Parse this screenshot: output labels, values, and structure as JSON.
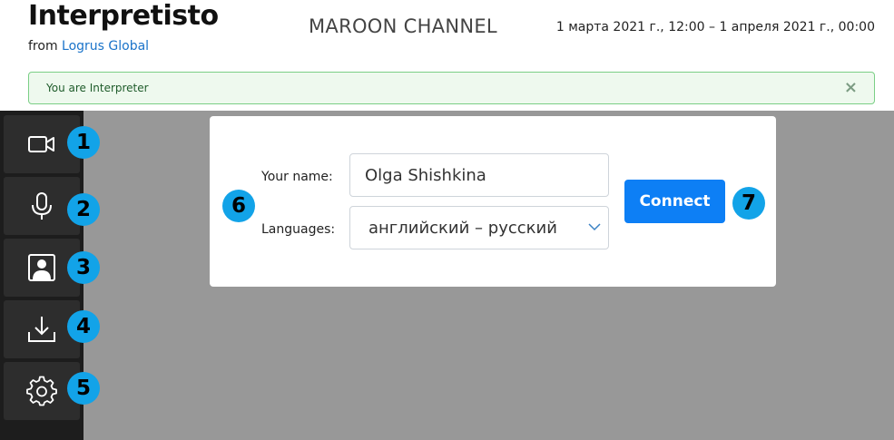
{
  "header": {
    "app_title": "Interpretisto",
    "from_prefix": "from ",
    "company_link": "Logrus Global",
    "channel": "MAROON CHANNEL",
    "date_range": "1 марта 2021 г., 12:00 – 1 апреля 2021 г., 00:00"
  },
  "alert": {
    "text": "You are Interpreter",
    "close_glyph": "×"
  },
  "sidebar": {
    "buttons": [
      {
        "icon": "video-camera-icon",
        "badge": "1"
      },
      {
        "icon": "microphone-icon",
        "badge": "2"
      },
      {
        "icon": "user-portrait-icon",
        "badge": "3"
      },
      {
        "icon": "download-icon",
        "badge": "4"
      },
      {
        "icon": "gear-icon",
        "badge": "5"
      }
    ]
  },
  "form": {
    "badge": "6",
    "name_label": "Your name:",
    "name_value": "Olga Shishkina",
    "languages_label": "Languages:",
    "languages_value": "английский – русский",
    "connect_label": "Connect",
    "connect_badge": "7"
  },
  "colors": {
    "accent": "#0d7ff5",
    "badge": "#12a3e8",
    "alert_bg": "#eef9ee",
    "alert_border": "#7bcf86",
    "sidebar": "#1d1d1d",
    "stage": "#989898"
  }
}
